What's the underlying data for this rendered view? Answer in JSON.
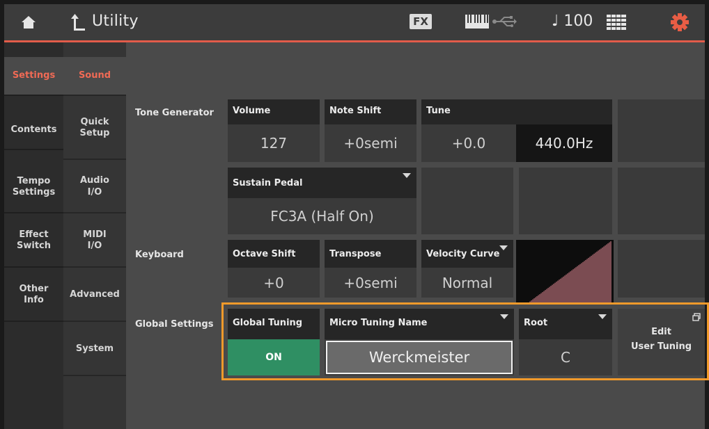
{
  "header": {
    "title": "Utility",
    "fx_label": "FX",
    "tempo": "♩ 100"
  },
  "tabs_primary": [
    {
      "label": "Settings"
    },
    {
      "label": "Contents"
    },
    {
      "label": "Tempo\nSettings"
    },
    {
      "label": "Effect\nSwitch"
    },
    {
      "label": "Other\nInfo"
    }
  ],
  "tabs_secondary": [
    {
      "label": "Sound"
    },
    {
      "label": "Quick\nSetup"
    },
    {
      "label": "Audio\nI/O"
    },
    {
      "label": "MIDI\nI/O"
    },
    {
      "label": "Advanced"
    },
    {
      "label": "System"
    }
  ],
  "sections": {
    "tone_generator": "Tone Generator",
    "keyboard": "Keyboard",
    "global_settings": "Global Settings"
  },
  "params": {
    "volume": {
      "label": "Volume",
      "value": "127"
    },
    "note_shift": {
      "label": "Note Shift",
      "value": "+0semi"
    },
    "tune": {
      "label": "Tune",
      "value": "+0.0",
      "hz": "440.0Hz"
    },
    "sustain_pedal": {
      "label": "Sustain Pedal",
      "value": "FC3A (Half On)"
    },
    "octave_shift": {
      "label": "Octave Shift",
      "value": "+0"
    },
    "transpose": {
      "label": "Transpose",
      "value": "+0semi"
    },
    "velocity_curve": {
      "label": "Velocity Curve",
      "value": "Normal"
    },
    "global_tuning": {
      "label": "Global Tuning",
      "value": "ON"
    },
    "micro_tuning_name": {
      "label": "Micro Tuning Name",
      "value": "Werckmeister"
    },
    "root": {
      "label": "Root",
      "value": "C"
    },
    "edit_user_tuning": {
      "label": "Edit\nUser Tuning"
    }
  },
  "colors": {
    "accent": "#e25c4a",
    "highlight": "#f19a2b",
    "on_green": "#2f8f63",
    "curve": "#e98a96"
  }
}
